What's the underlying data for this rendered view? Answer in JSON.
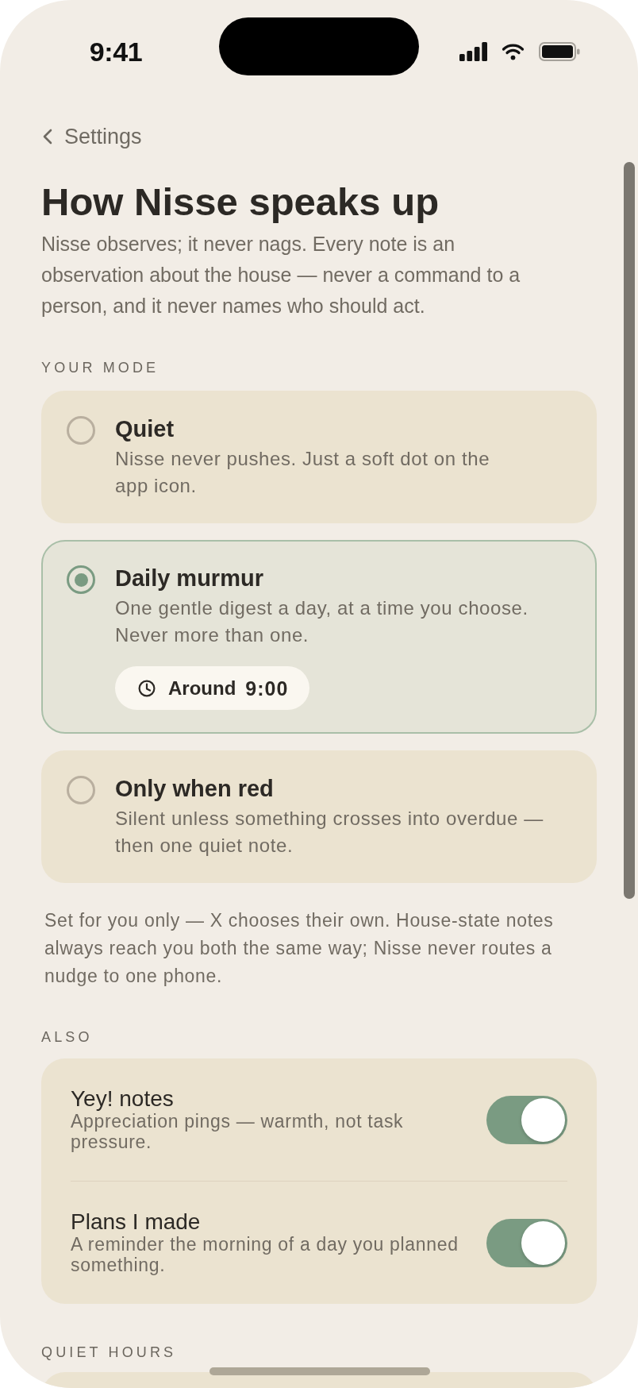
{
  "status_bar": {
    "time": "9:41"
  },
  "nav": {
    "back_label": "Settings"
  },
  "header": {
    "title": "How Nisse speaks up",
    "description": "Nisse observes; it never nags. Every note is an observation about the house — never a command to a person, and it never names who should act."
  },
  "mode_section": {
    "heading": "YOUR MODE",
    "options": [
      {
        "title": "Quiet",
        "description": "Nisse never pushes. Just a soft dot on the app icon.",
        "selected": false
      },
      {
        "title": "Daily murmur",
        "description": "One gentle digest a day, at a time you choose. Never more than one.",
        "selected": true,
        "time_chip": {
          "label": "Around",
          "time": "9:00"
        }
      },
      {
        "title": "Only when red",
        "description": "Silent unless something crosses into overdue — then one quiet note.",
        "selected": false
      }
    ],
    "footnote": "Set for you only — X chooses their own. House-state notes always reach you both the same way; Nisse never routes a nudge to one phone."
  },
  "also_section": {
    "heading": "ALSO",
    "items": [
      {
        "title": "Yey! notes",
        "description": "Appreciation pings — warmth, not task pressure.",
        "on": true
      },
      {
        "title": "Plans I made",
        "description": "A reminder the morning of a day you planned something.",
        "on": true
      }
    ]
  },
  "quiet_hours_section": {
    "heading": "QUIET HOURS"
  }
}
